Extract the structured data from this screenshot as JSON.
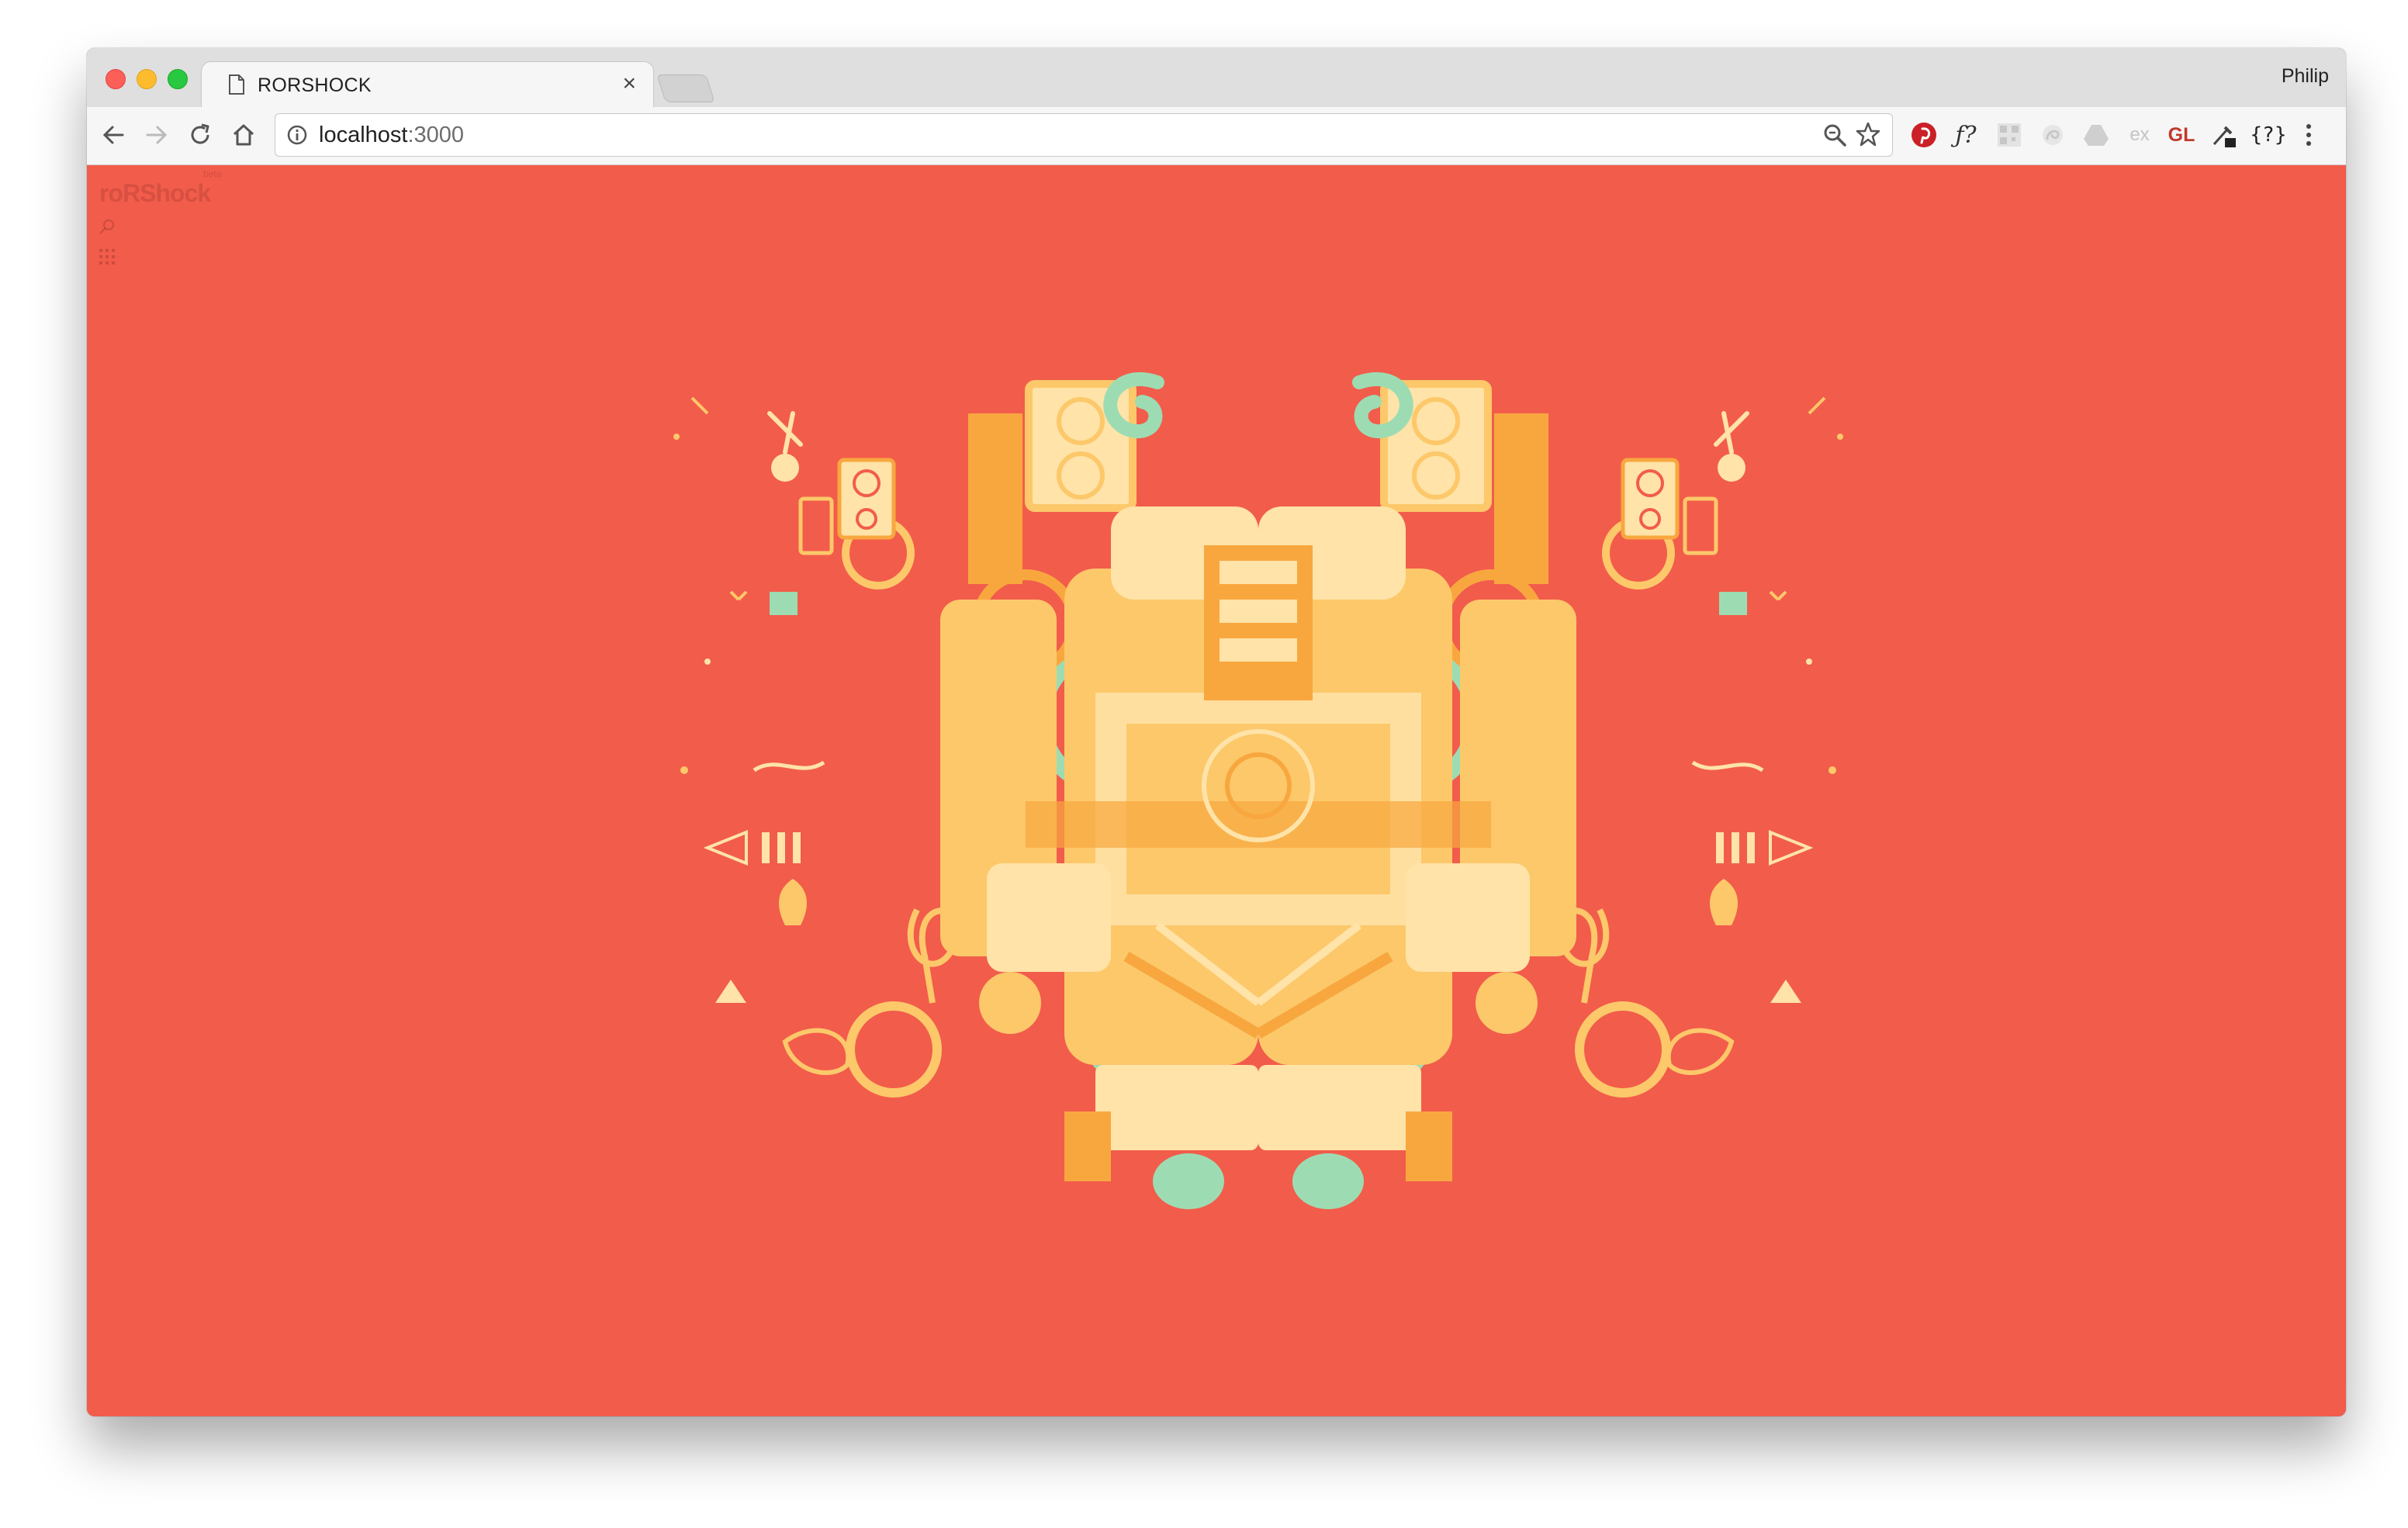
{
  "browser": {
    "tab": {
      "title": "RORSHOCK",
      "close_glyph": "×"
    },
    "profile": {
      "name": "Philip"
    },
    "omnibox": {
      "host": "localhost",
      "port": ":3000"
    },
    "extensions": [
      "pinterest-icon",
      "f-question-icon",
      "qr-icon",
      "swirl-icon",
      "drive-icon",
      "ex-icon",
      "gl-icon",
      "eyedropper-icon",
      "json-formatter-icon",
      "menu-icon"
    ],
    "extension_labels": {
      "f": "ƒ?",
      "ex": "ex",
      "gl": "GL",
      "json": "{?}"
    }
  },
  "page": {
    "logo": "roRShock",
    "logo_badge": "beta",
    "background_color": "#f25c4b",
    "palette": [
      "#fcc86a",
      "#f8a73f",
      "#ffe3a8",
      "#9ddcb3",
      "#f25c4b"
    ]
  }
}
